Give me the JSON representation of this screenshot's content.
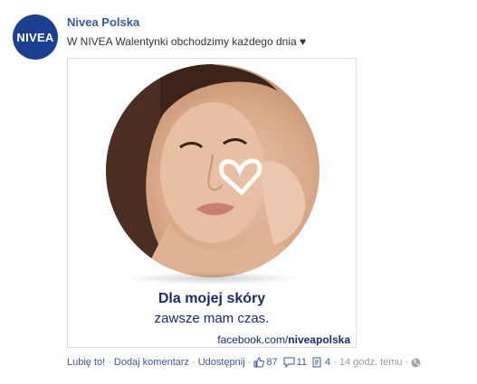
{
  "post": {
    "avatar_text": "NIVEA",
    "page_name": "Nivea Polska",
    "text": "W NIVEA Walentynki obchodzimy każdego dnia ♥"
  },
  "image": {
    "slogan_line1": "Dla mojej skóry",
    "slogan_line2": "zawsze mam czas.",
    "url_prefix": "facebook.com/",
    "url_bold": "niveapolska"
  },
  "actions": {
    "like": "Lubię to!",
    "comment": "Dodaj komentarz",
    "share": "Udostępnij",
    "likes_count": "87",
    "comments_count": "11",
    "shares_count": "4",
    "time": "14 godz. temu"
  },
  "icons": {
    "like": "thumbs-up-icon",
    "comment": "comment-bubble-icon",
    "share": "share-doc-icon",
    "privacy": "globe-icon"
  },
  "colors": {
    "brand": "#1c3f91",
    "link": "#3b5998",
    "slogan": "#1c2a6b"
  }
}
